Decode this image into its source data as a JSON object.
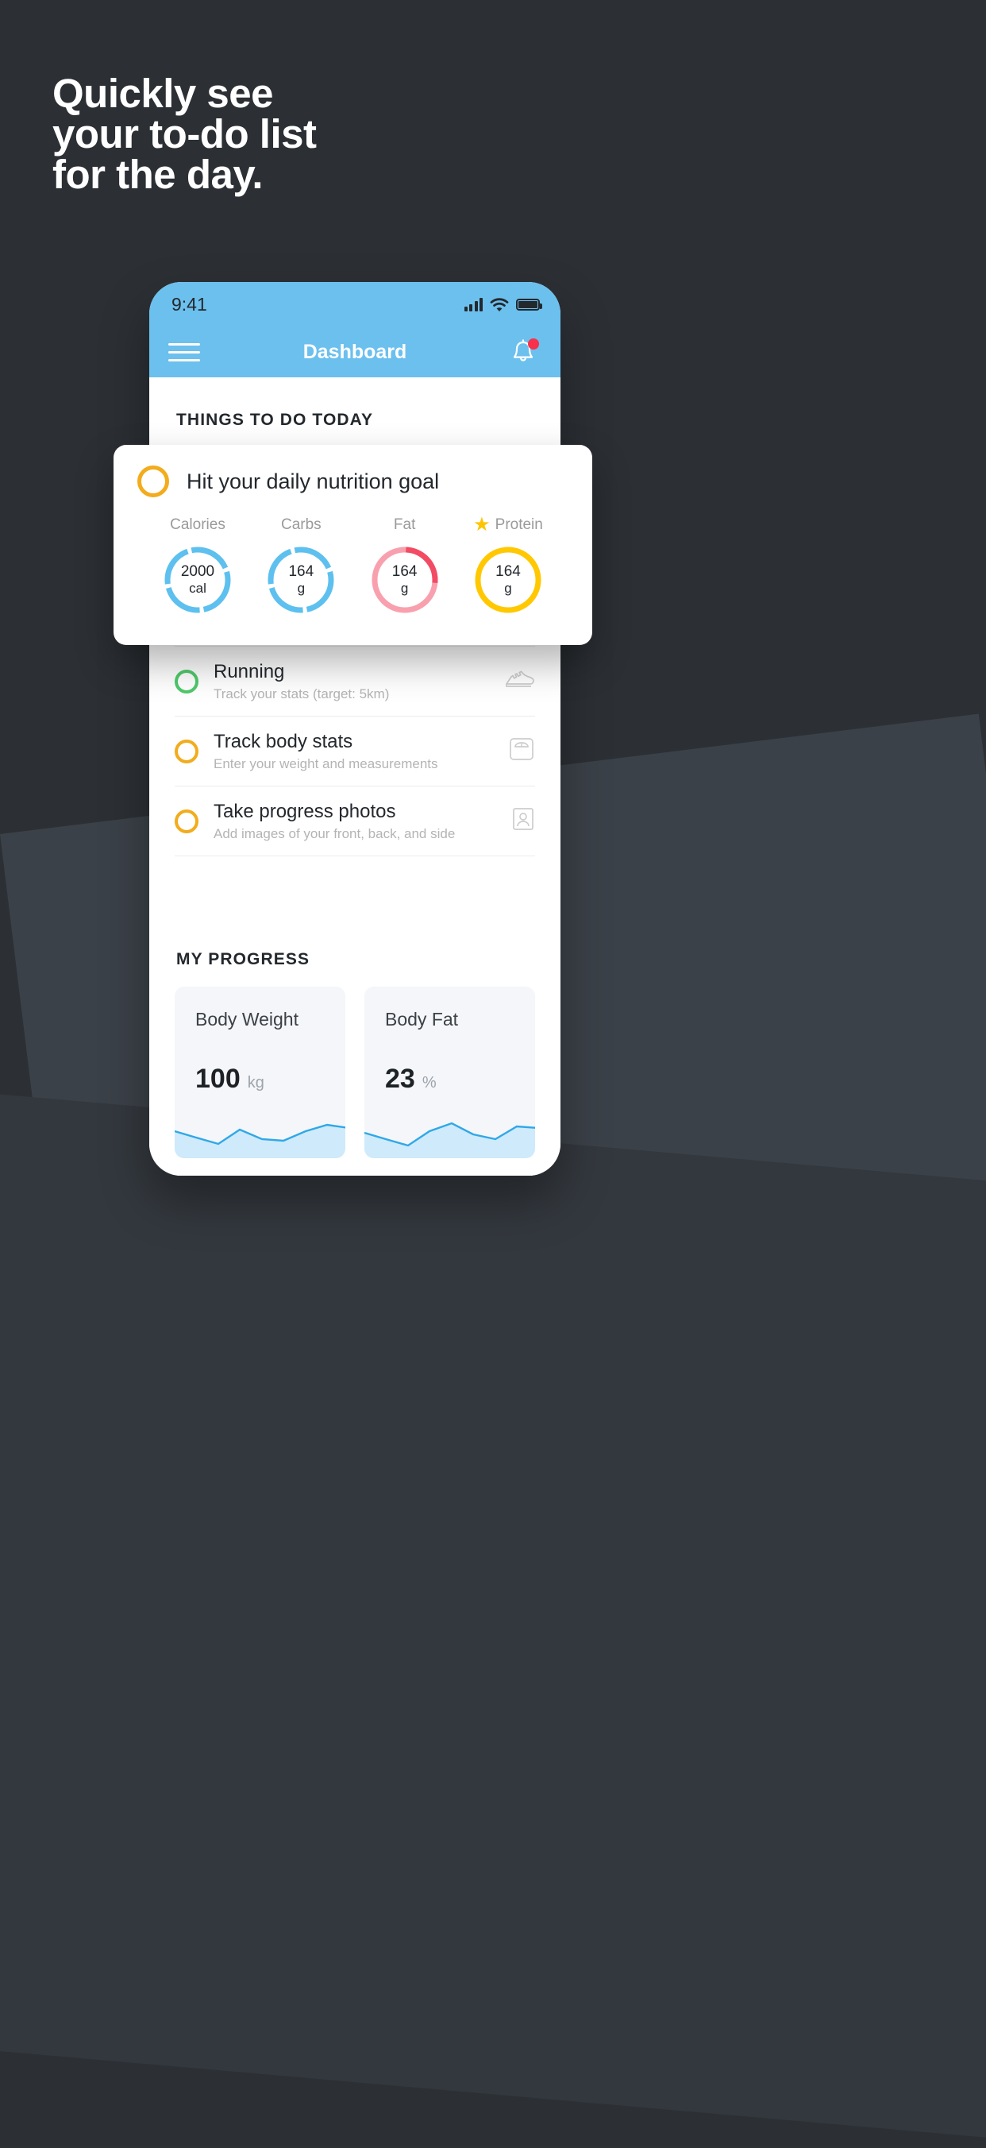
{
  "promo": {
    "headline_lines": [
      "Quickly see",
      "your to-do list",
      "for the day."
    ],
    "bg_color": "#2c3035",
    "text_color": "#ffffff"
  },
  "phone": {
    "status_bar": {
      "time": "9:41",
      "signal_icon": "signal-bars-icon",
      "wifi_icon": "wifi-icon",
      "battery_icon": "battery-icon"
    },
    "app_bar": {
      "menu_icon": "hamburger-menu-icon",
      "title": "Dashboard",
      "bell_icon": "notification-bell-icon",
      "has_badge": true,
      "badge_color": "#f8304a",
      "bar_color": "#6cc0ee"
    },
    "sections": {
      "todo_heading": "THINGS TO DO TODAY",
      "progress_heading": "MY PROGRESS"
    },
    "todos": [
      {
        "title": "Running",
        "subtitle": "Track your stats (target: 5km)",
        "ring_color": "#4fc96b",
        "icon": "running-shoe-icon"
      },
      {
        "title": "Track body stats",
        "subtitle": "Enter your weight and measurements",
        "ring_color": "#f2ac1c",
        "icon": "weight-scale-icon"
      },
      {
        "title": "Take progress photos",
        "subtitle": "Add images of your front, back, and side",
        "ring_color": "#f2ac1c",
        "icon": "person-photo-icon"
      }
    ],
    "progress_cards": [
      {
        "label": "Body Weight",
        "value": "100",
        "unit": "kg"
      },
      {
        "label": "Body Fat",
        "value": "23",
        "unit": "%"
      }
    ]
  },
  "nutrition_card": {
    "ring_color": "#f2ac1c",
    "title": "Hit your daily nutrition goal",
    "macros": [
      {
        "label": "Calories",
        "value": "2000",
        "unit": "cal",
        "color": "#5dc0ef",
        "starred": false
      },
      {
        "label": "Carbs",
        "value": "164",
        "unit": "g",
        "color": "#5dc0ef",
        "starred": false
      },
      {
        "label": "Fat",
        "value": "164",
        "unit": "g",
        "color": "#f9a0ae",
        "accent": "#f24b63",
        "starred": false
      },
      {
        "label": "Protein",
        "value": "164",
        "unit": "g",
        "color": "#ffc800",
        "starred": true,
        "star_icon": "star-icon"
      }
    ]
  },
  "chart_data": [
    {
      "type": "area",
      "title": "Body Weight",
      "ylabel": "kg",
      "x": [
        0,
        1,
        2,
        3,
        4,
        5,
        6,
        7
      ],
      "values": [
        52,
        44,
        33,
        48,
        66,
        50,
        46,
        60,
        70
      ],
      "line_color": "#2fa8e8",
      "fill_color": "#cfeafa"
    },
    {
      "type": "area",
      "title": "Body Fat",
      "ylabel": "%",
      "x": [
        0,
        1,
        2,
        3,
        4,
        5,
        6,
        7
      ],
      "values": [
        50,
        40,
        30,
        50,
        70,
        52,
        44,
        66,
        64
      ],
      "line_color": "#2fa8e8",
      "fill_color": "#cfeafa"
    }
  ]
}
